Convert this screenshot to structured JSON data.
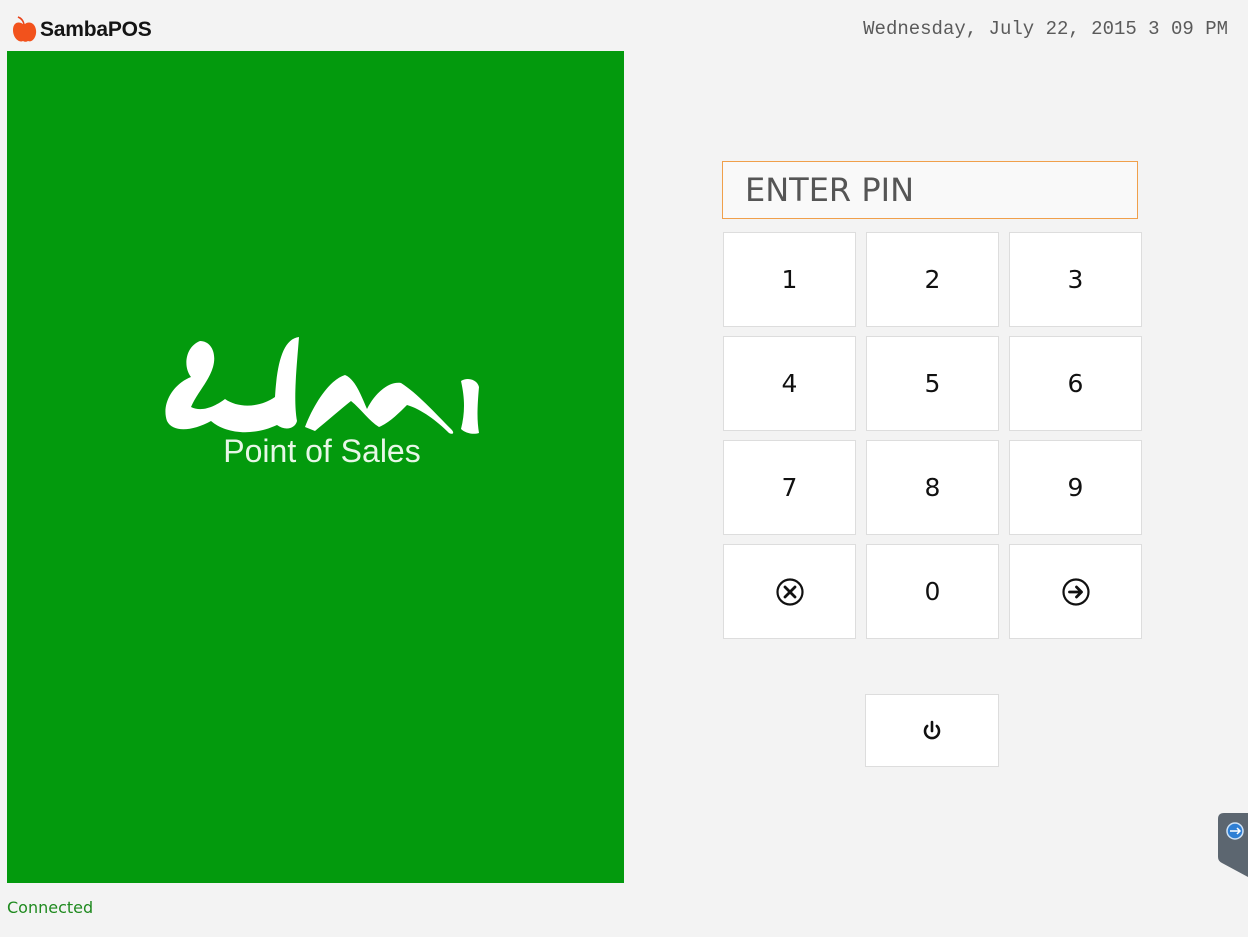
{
  "header": {
    "brand": "SambaPOS",
    "datetime": "Wednesday, July 22, 2015 3 09 PM"
  },
  "splash": {
    "logo_text": "umi",
    "subtitle": "Point of Sales",
    "background_color": "#039a0d"
  },
  "pin": {
    "placeholder": "ENTER PIN",
    "value": ""
  },
  "keypad": {
    "keys": [
      {
        "label": "1"
      },
      {
        "label": "2"
      },
      {
        "label": "3"
      },
      {
        "label": "4"
      },
      {
        "label": "5"
      },
      {
        "label": "6"
      },
      {
        "label": "7"
      },
      {
        "label": "8"
      },
      {
        "label": "9"
      },
      {
        "icon": "clear-circle-x-icon"
      },
      {
        "label": "0"
      },
      {
        "icon": "enter-circle-arrow-icon"
      }
    ]
  },
  "shutdown": {
    "icon": "power-icon"
  },
  "status": {
    "text": "Connected",
    "color": "#1f8a1f"
  },
  "side_tab": {
    "icon": "teamviewer-icon"
  },
  "colors": {
    "accent_orange": "#f0a04b",
    "background": "#f3f3f3"
  }
}
